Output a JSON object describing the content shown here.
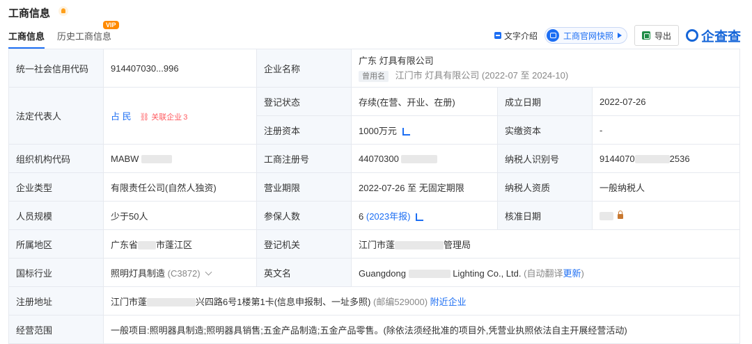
{
  "header": {
    "title": "工商信息",
    "tabs": [
      {
        "label": "工商信息",
        "active": true
      },
      {
        "label": "历史工商信息",
        "active": false
      }
    ],
    "vip_badge": "VIP"
  },
  "toolbar": {
    "text_intro": "文字介绍",
    "snapshot": "工商官网快照",
    "export": "导出",
    "brand": "企查查"
  },
  "colors": {
    "accent": "#1c6ef3",
    "label_bg": "#f5f8fc",
    "vip": "#ff8a00",
    "brand": "#1565d8"
  },
  "icons": [
    "bell-icon",
    "doc-icon",
    "snapshot-icon",
    "play-icon",
    "excel-icon",
    "brand-logo-icon",
    "trend-chart-icon",
    "related-link-icon",
    "lock-icon",
    "chevron-down-icon"
  ],
  "table": {
    "credit_code_label": "统一社会信用代码",
    "credit_code_value": "914407030...996",
    "company_name_label": "企业名称",
    "company_name_value": "广东 灯具有限公司",
    "former_name_tag": "曾用名",
    "former_name_value": "江门市 灯具有限公司",
    "former_name_period": "(2022-07 至 2024-10)",
    "legal_rep_label": "法定代表人",
    "legal_rep_value": "占 民",
    "related_company_label": "关联企业",
    "related_company_count": "3",
    "reg_status_label": "登记状态",
    "reg_status_value": "存续(在营、开业、在册)",
    "established_label": "成立日期",
    "established_value": "2022-07-26",
    "reg_capital_label": "注册资本",
    "reg_capital_value": "1000万元",
    "paid_capital_label": "实缴资本",
    "paid_capital_value": "-",
    "org_code_label": "组织机构代码",
    "org_code_value": "MABW",
    "business_reg_label": "工商注册号",
    "business_reg_value": "44070300",
    "taxpayer_id_label": "纳税人识别号",
    "taxpayer_id_value_prefix": "9144070",
    "taxpayer_id_value_suffix": "2536",
    "company_type_label": "企业类型",
    "company_type_value": "有限责任公司(自然人独资)",
    "biz_term_label": "营业期限",
    "biz_term_value": "2022-07-26 至 无固定期限",
    "taxpayer_qual_label": "纳税人资质",
    "taxpayer_qual_value": "一般纳税人",
    "staff_size_label": "人员规模",
    "staff_size_value": "少于50人",
    "insured_label": "参保人数",
    "insured_value": "6",
    "insured_year": "(2023年报)",
    "approval_date_label": "核准日期",
    "region_label": "所属地区",
    "region_value_prefix": "广东省",
    "region_value_suffix": "市蓬江区",
    "reg_authority_label": "登记机关",
    "reg_authority_prefix": "江门市蓬",
    "reg_authority_suffix": "管理局",
    "industry_label": "国标行业",
    "industry_value": "照明灯具制造",
    "industry_code": "(C3872)",
    "english_name_label": "英文名",
    "english_name_prefix": "Guangdong",
    "english_name_suffix": "Lighting Co., Ltd.",
    "auto_translate": "(自动翻译",
    "update_link": "更新",
    "close_paren": ")",
    "address_label": "注册地址",
    "address_prefix": "江门市蓬",
    "address_suffix": "兴四路6号1楼第1卡(信息申报制、一址多照)",
    "postcode": "(邮编529000)",
    "nearby_link": "附近企业",
    "scope_label": "经营范围",
    "scope_value": "一般项目:照明器具制造;照明器具销售;五金产品制造;五金产品零售。(除依法须经批准的项目外,凭营业执照依法自主开展经营活动)"
  }
}
